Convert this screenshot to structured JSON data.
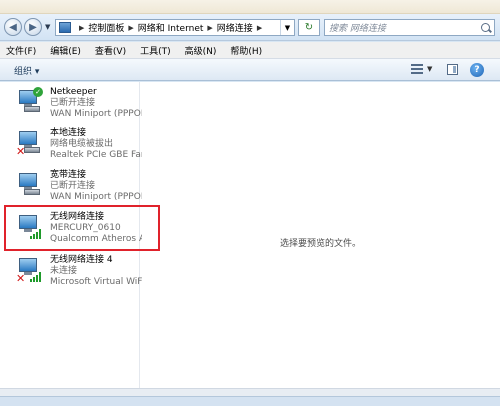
{
  "nav": {
    "breadcrumb": [
      "控制面板",
      "网络和 Internet",
      "网络连接"
    ],
    "search_placeholder": "搜索 网络连接"
  },
  "menu": [
    "文件(F)",
    "编辑(E)",
    "查看(V)",
    "工具(T)",
    "高级(N)",
    "帮助(H)"
  ],
  "toolbar": {
    "organize_label": "组织 ▾"
  },
  "connections": [
    {
      "name": "Netkeeper",
      "status": "已断开连接",
      "device": "WAN Miniport (PPPOE)",
      "indicator": "check"
    },
    {
      "name": "本地连接",
      "status": "网络电缆被拔出",
      "device": "Realtek PCIe GBE Family",
      "indicator": "x"
    },
    {
      "name": "宽带连接",
      "status": "已断开连接",
      "device": "WAN Miniport (PPPOE)",
      "indicator": "none"
    },
    {
      "name": "无线网络连接",
      "status": "MERCURY_0610",
      "device": "Qualcomm Atheros AR",
      "indicator": "signal"
    },
    {
      "name": "无线网络连接 4",
      "status": "未连接",
      "device": "Microsoft Virtual WiFi",
      "indicator": "x-signal"
    }
  ],
  "details": {
    "empty_message": "选择要预览的文件。"
  },
  "colors": {
    "highlight_border": "#e0222b",
    "connected_green": "#2fa33a",
    "error_red": "#d01515"
  }
}
